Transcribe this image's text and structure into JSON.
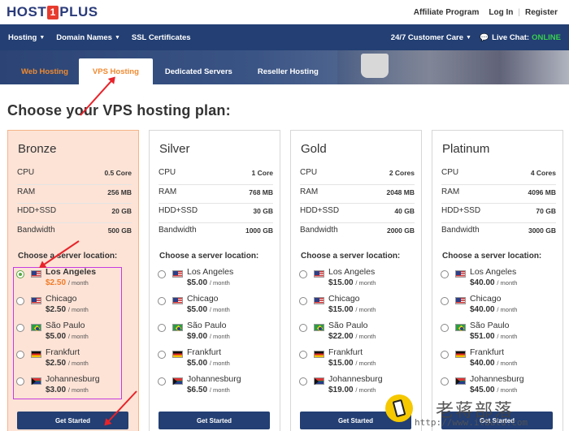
{
  "logo": {
    "part1": "HOST",
    "part2": "1",
    "part3": "PLUS"
  },
  "top_links": [
    "Affiliate Program",
    "Log In",
    "Register"
  ],
  "nav": {
    "left": [
      {
        "label": "Hosting",
        "caret": true
      },
      {
        "label": "Domain Names",
        "caret": true
      },
      {
        "label": "SSL Certificates",
        "caret": false
      }
    ],
    "support": "24/7 Customer Care",
    "chat_label": "Live Chat:",
    "chat_status": "ONLINE"
  },
  "tabs": [
    "Web Hosting",
    "VPS Hosting",
    "Dedicated Servers",
    "Reseller Hosting"
  ],
  "heading": "Choose your VPS hosting plan:",
  "location_title": "Choose a server location:",
  "button_label": "Get Started",
  "per_month": "/ month",
  "plans": [
    {
      "name": "Bronze",
      "specs": [
        {
          "k": "CPU",
          "v": "0.5 Core"
        },
        {
          "k": "RAM",
          "v": "256 MB"
        },
        {
          "k": "HDD+SSD",
          "v": "20 GB"
        },
        {
          "k": "Bandwidth",
          "v": "500 GB"
        }
      ],
      "locations": [
        {
          "city": "Los Angeles",
          "price": "$2.50",
          "flag": "us"
        },
        {
          "city": "Chicago",
          "price": "$2.50",
          "flag": "us"
        },
        {
          "city": "São Paulo",
          "price": "$5.00",
          "flag": "br"
        },
        {
          "city": "Frankfurt",
          "price": "$2.50",
          "flag": "de"
        },
        {
          "city": "Johannesburg",
          "price": "$3.00",
          "flag": "za"
        }
      ]
    },
    {
      "name": "Silver",
      "specs": [
        {
          "k": "CPU",
          "v": "1 Core"
        },
        {
          "k": "RAM",
          "v": "768 MB"
        },
        {
          "k": "HDD+SSD",
          "v": "30 GB"
        },
        {
          "k": "Bandwidth",
          "v": "1000 GB"
        }
      ],
      "locations": [
        {
          "city": "Los Angeles",
          "price": "$5.00",
          "flag": "us"
        },
        {
          "city": "Chicago",
          "price": "$5.00",
          "flag": "us"
        },
        {
          "city": "São Paulo",
          "price": "$9.00",
          "flag": "br"
        },
        {
          "city": "Frankfurt",
          "price": "$5.00",
          "flag": "de"
        },
        {
          "city": "Johannesburg",
          "price": "$6.50",
          "flag": "za"
        }
      ]
    },
    {
      "name": "Gold",
      "specs": [
        {
          "k": "CPU",
          "v": "2 Cores"
        },
        {
          "k": "RAM",
          "v": "2048 MB"
        },
        {
          "k": "HDD+SSD",
          "v": "40 GB"
        },
        {
          "k": "Bandwidth",
          "v": "2000 GB"
        }
      ],
      "locations": [
        {
          "city": "Los Angeles",
          "price": "$15.00",
          "flag": "us"
        },
        {
          "city": "Chicago",
          "price": "$15.00",
          "flag": "us"
        },
        {
          "city": "São Paulo",
          "price": "$22.00",
          "flag": "br"
        },
        {
          "city": "Frankfurt",
          "price": "$15.00",
          "flag": "de"
        },
        {
          "city": "Johannesburg",
          "price": "$19.00",
          "flag": "za"
        }
      ]
    },
    {
      "name": "Platinum",
      "specs": [
        {
          "k": "CPU",
          "v": "4 Cores"
        },
        {
          "k": "RAM",
          "v": "4096 MB"
        },
        {
          "k": "HDD+SSD",
          "v": "70 GB"
        },
        {
          "k": "Bandwidth",
          "v": "3000 GB"
        }
      ],
      "locations": [
        {
          "city": "Los Angeles",
          "price": "$40.00",
          "flag": "us"
        },
        {
          "city": "Chicago",
          "price": "$40.00",
          "flag": "us"
        },
        {
          "city": "São Paulo",
          "price": "$51.00",
          "flag": "br"
        },
        {
          "city": "Frankfurt",
          "price": "$40.00",
          "flag": "de"
        },
        {
          "city": "Johannesburg",
          "price": "$45.00",
          "flag": "za"
        }
      ]
    }
  ],
  "watermark": {
    "text_cn": "老蒋部落",
    "url": "http://www.itbulu.com"
  },
  "colors": {
    "navy": "#233f73",
    "accent_orange": "#f07c2a",
    "online_green": "#37d14d",
    "annotation_red": "#e8232a",
    "highlight_box": "#c63ce0"
  }
}
